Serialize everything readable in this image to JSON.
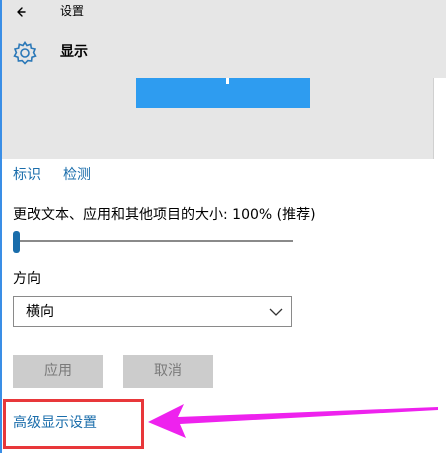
{
  "header": {
    "app_title": "设置",
    "page_title": "显示",
    "back_icon": "back-arrow-icon",
    "page_icon": "gear-icon"
  },
  "links": {
    "identify": "标识",
    "detect": "检测"
  },
  "scale": {
    "label": "更改文本、应用和其他项目的大小: 100% (推荐)",
    "slider_value": 0
  },
  "orientation": {
    "label": "方向",
    "selected": "横向"
  },
  "buttons": {
    "apply": "应用",
    "cancel": "取消"
  },
  "advanced": {
    "link": "高级显示设置"
  },
  "colors": {
    "accent": "#1a6dab",
    "monitor": "#2e9cf0",
    "highlight_box": "#e8373a",
    "arrow": "#ee22ee"
  }
}
